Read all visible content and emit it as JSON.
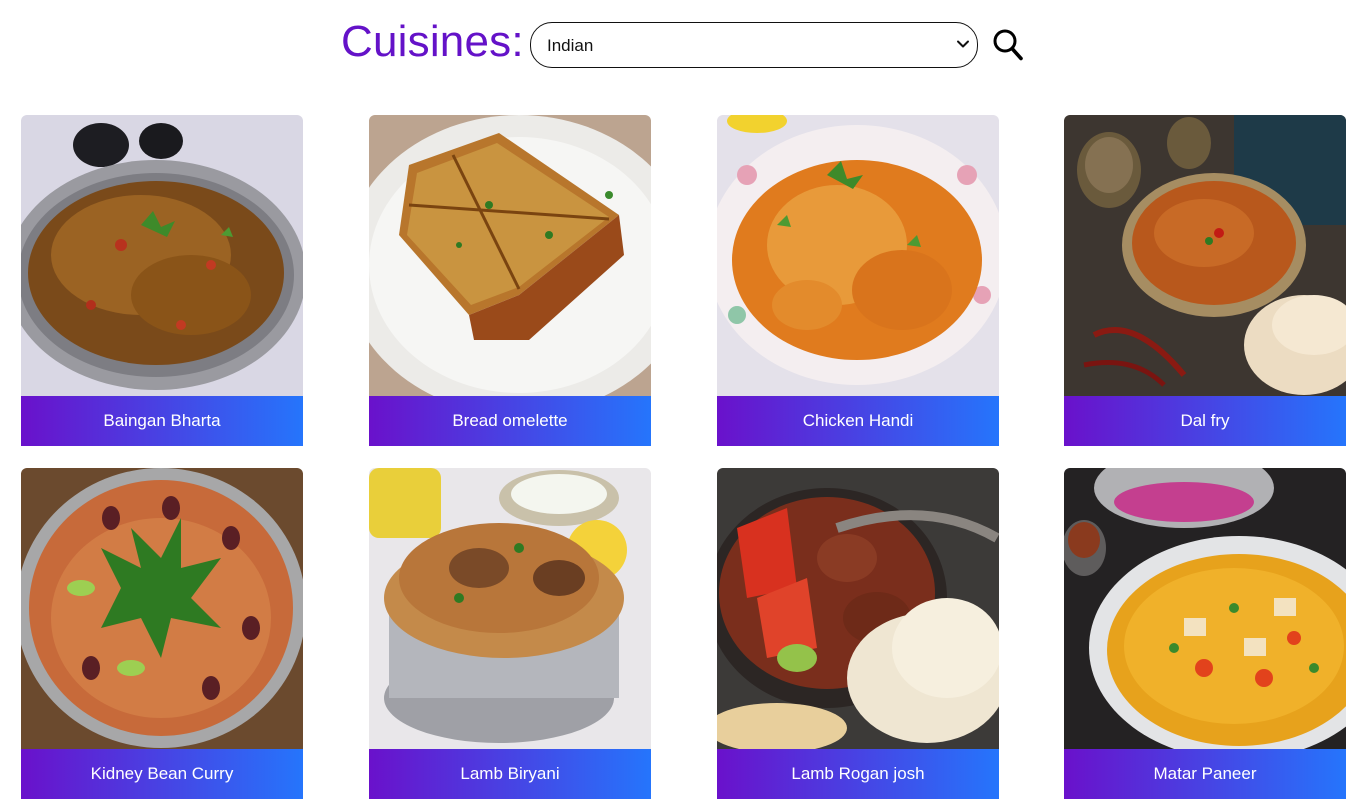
{
  "header": {
    "title": "Cuisines:",
    "selected_cuisine": "Indian",
    "search_icon": "search-icon"
  },
  "dishes": [
    {
      "name": "Baingan Bharta"
    },
    {
      "name": "Bread omelette"
    },
    {
      "name": "Chicken Handi"
    },
    {
      "name": "Dal fry"
    },
    {
      "name": "Kidney Bean Curry"
    },
    {
      "name": "Lamb Biryani"
    },
    {
      "name": "Lamb Rogan josh"
    },
    {
      "name": "Matar Paneer"
    }
  ],
  "colors": {
    "title": "#6412c8",
    "caption_gradient_start": "#6a11cb",
    "caption_gradient_end": "#2575fc"
  }
}
